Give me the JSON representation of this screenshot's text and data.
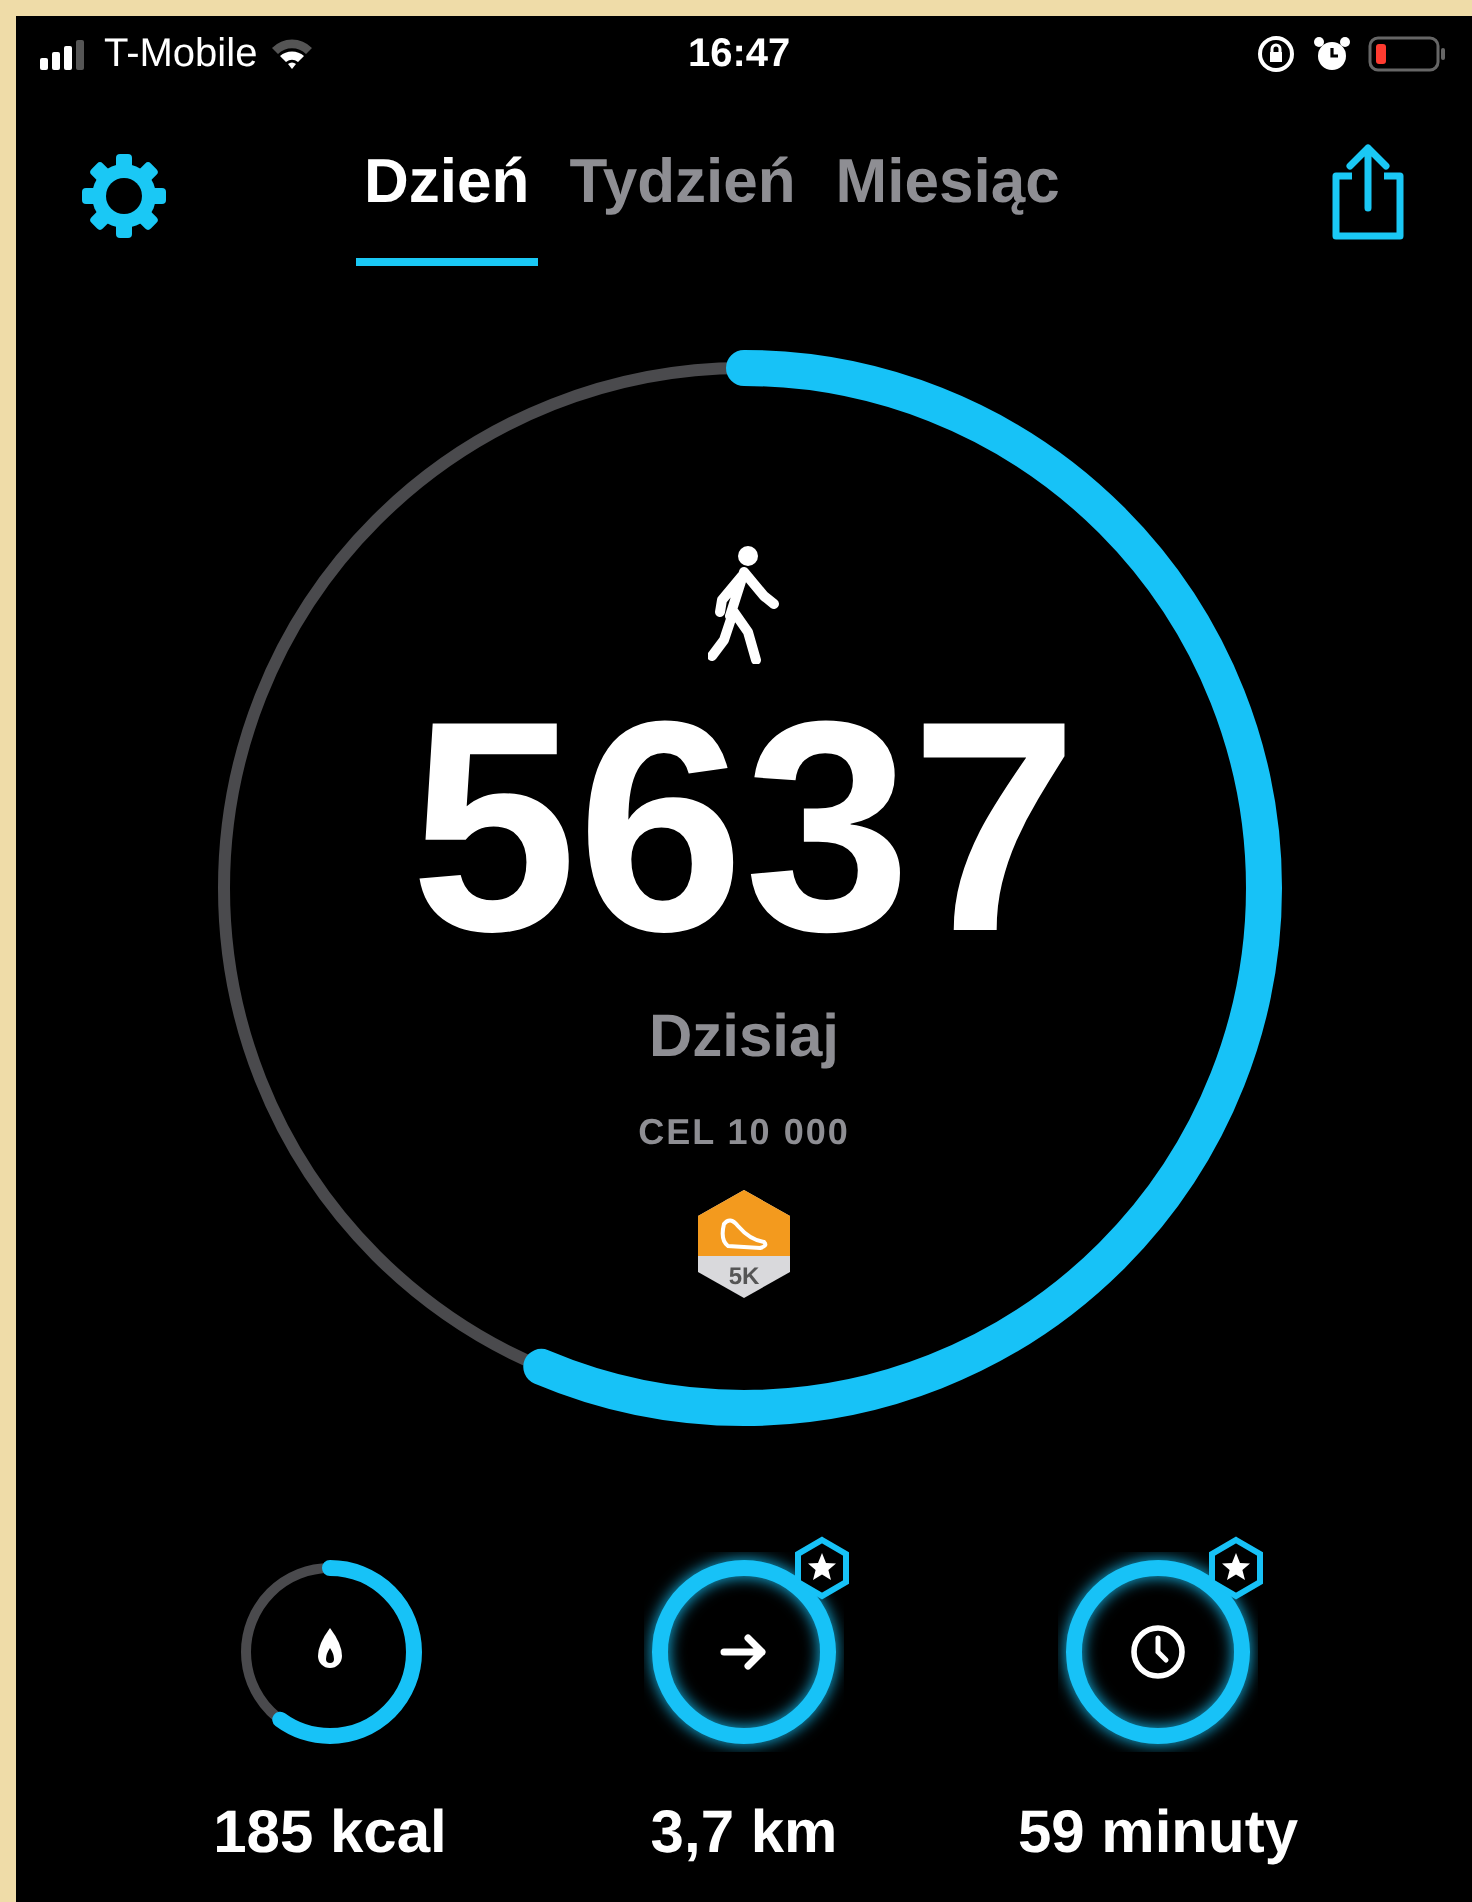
{
  "status_bar": {
    "carrier": "T-Mobile",
    "time": "16:47"
  },
  "tabs": [
    {
      "label": "Dzień",
      "selected": true
    },
    {
      "label": "Tydzień",
      "selected": false
    },
    {
      "label": "Miesiąc",
      "selected": false
    }
  ],
  "steps": {
    "value": "5637",
    "label": "Dzisiaj",
    "goal": "CEL 10 000",
    "level": 0.5637,
    "badge": "5K"
  },
  "stats": [
    {
      "kind": "calories",
      "value": "185 kcal",
      "level": 0.6,
      "achieved": false
    },
    {
      "kind": "distance",
      "value": "3,7 km",
      "level": 1,
      "achieved": true
    },
    {
      "kind": "time",
      "value": "59 minuty",
      "level": 1,
      "achieved": true
    }
  ]
}
